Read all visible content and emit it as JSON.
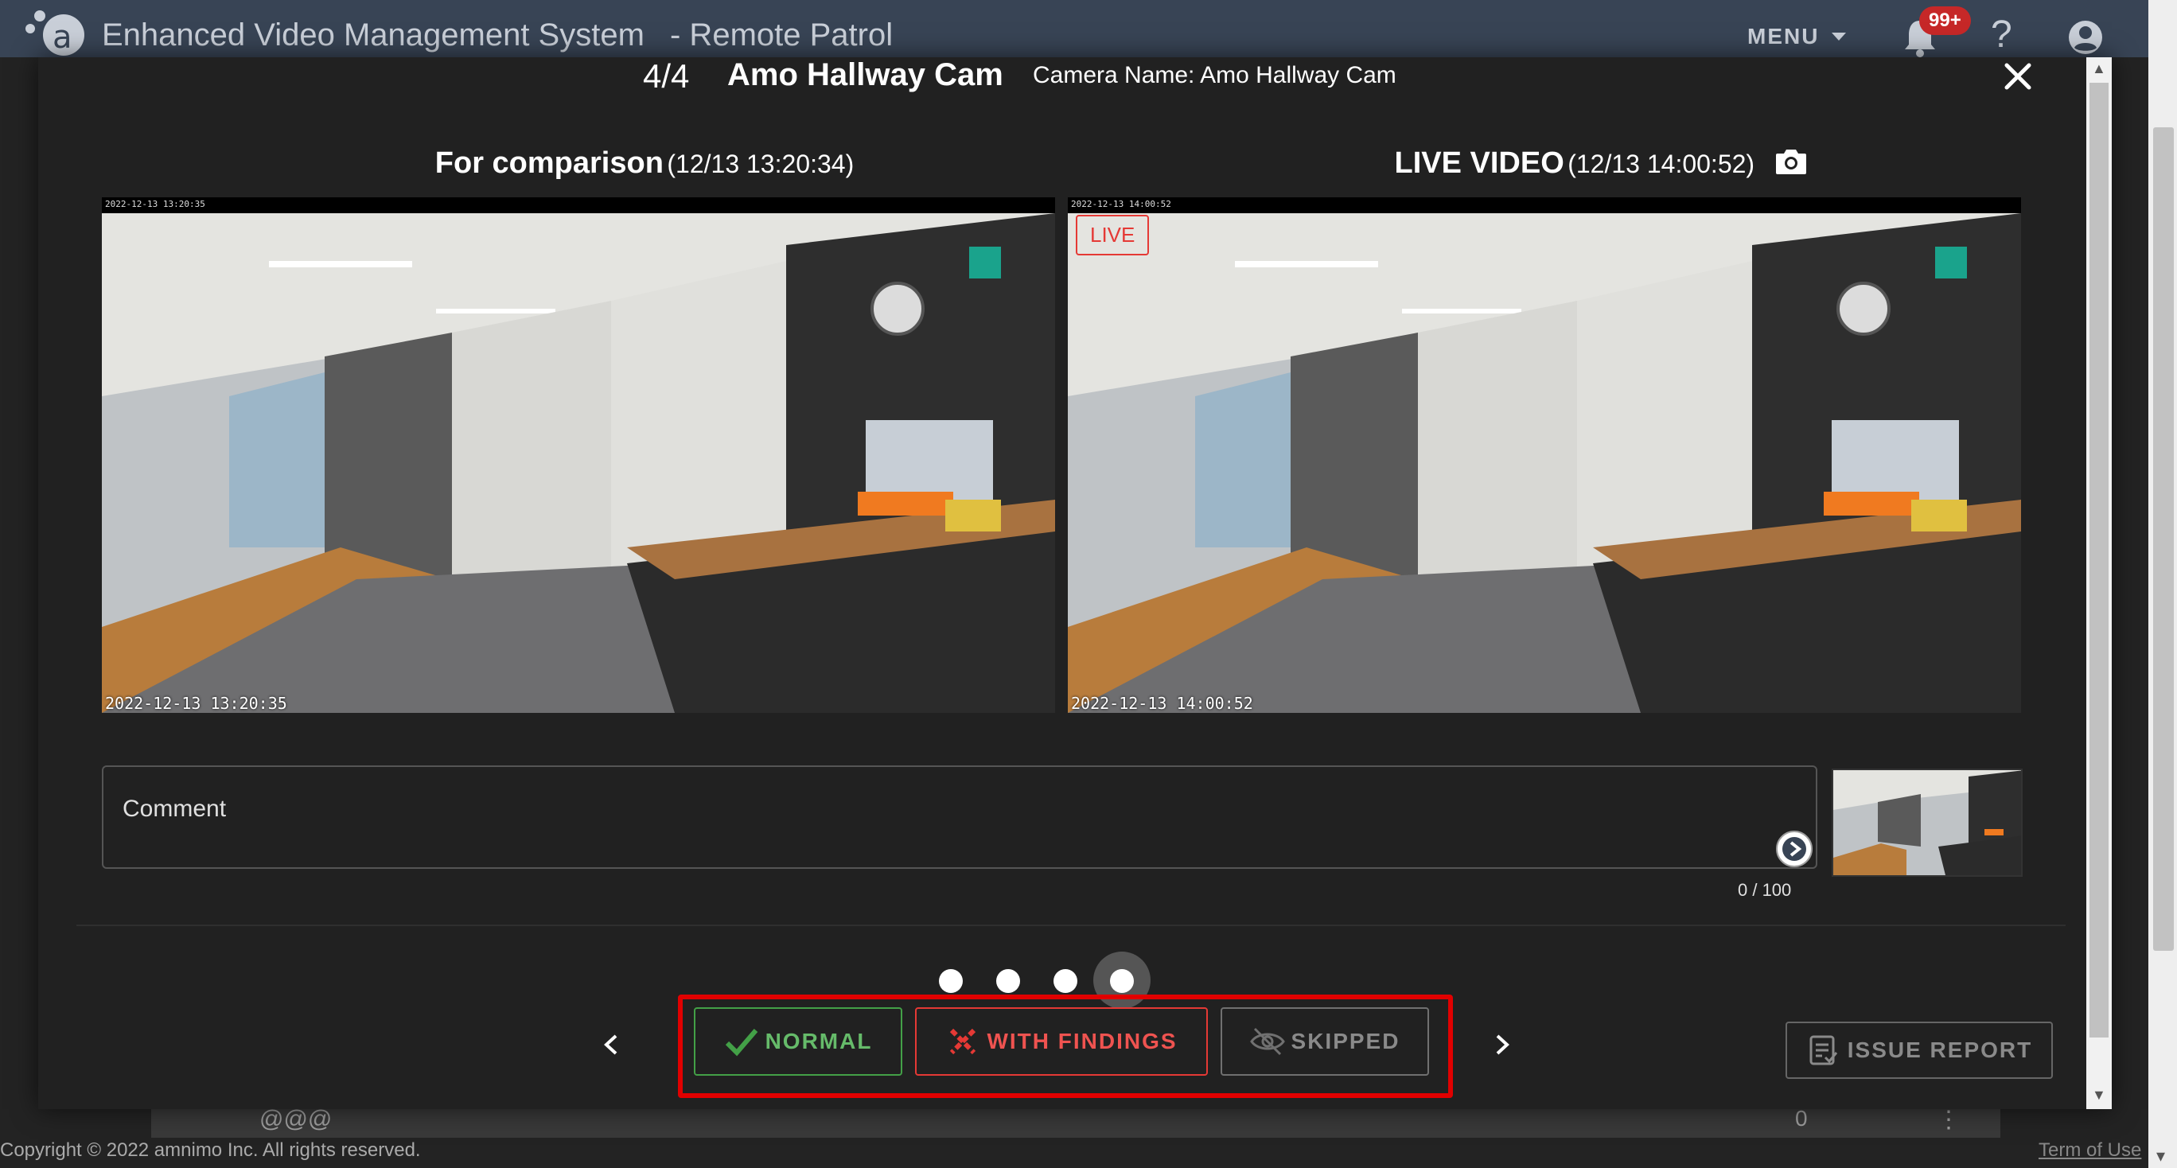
{
  "app": {
    "title": "Enhanced Video Management System",
    "subtitle": "- Remote Patrol",
    "menu_label": "MENU",
    "notification_count": "99+",
    "help_glyph": "?"
  },
  "modal": {
    "counter": "4/4",
    "title": "Amo Hallway Cam",
    "camera_name": "Camera Name: Amo Hallway Cam",
    "comparison": {
      "label": "For comparison",
      "time": "(12/13 13:20:34)",
      "osd_top": "2022-12-13 13:20:35",
      "osd_bottom": "2022-12-13 13:20:35"
    },
    "live": {
      "label": "LIVE VIDEO",
      "time": "(12/13 14:00:52)",
      "tag": "LIVE",
      "osd_top": "2022-12-13 14:00:52",
      "osd_bottom": "2022-12-13 14:00:52"
    },
    "comment": {
      "label": "Comment",
      "counter": "0 / 100"
    },
    "pager": {
      "total": 4,
      "current": 4
    },
    "buttons": {
      "normal": "NORMAL",
      "with_findings": "WITH FINDINGS",
      "skipped": "SKIPPED",
      "issue_report": "ISSUE REPORT"
    }
  },
  "background": {
    "row_text": "@@@",
    "row_count": "0",
    "row_more": "⋮",
    "copyright": "Copyright © 2022 amnimo Inc. All rights reserved.",
    "terms": "Term of Use"
  },
  "colors": {
    "topbar": "#384455",
    "normal": "#43a047",
    "findings": "#e53935",
    "highlight": "#e10000"
  }
}
